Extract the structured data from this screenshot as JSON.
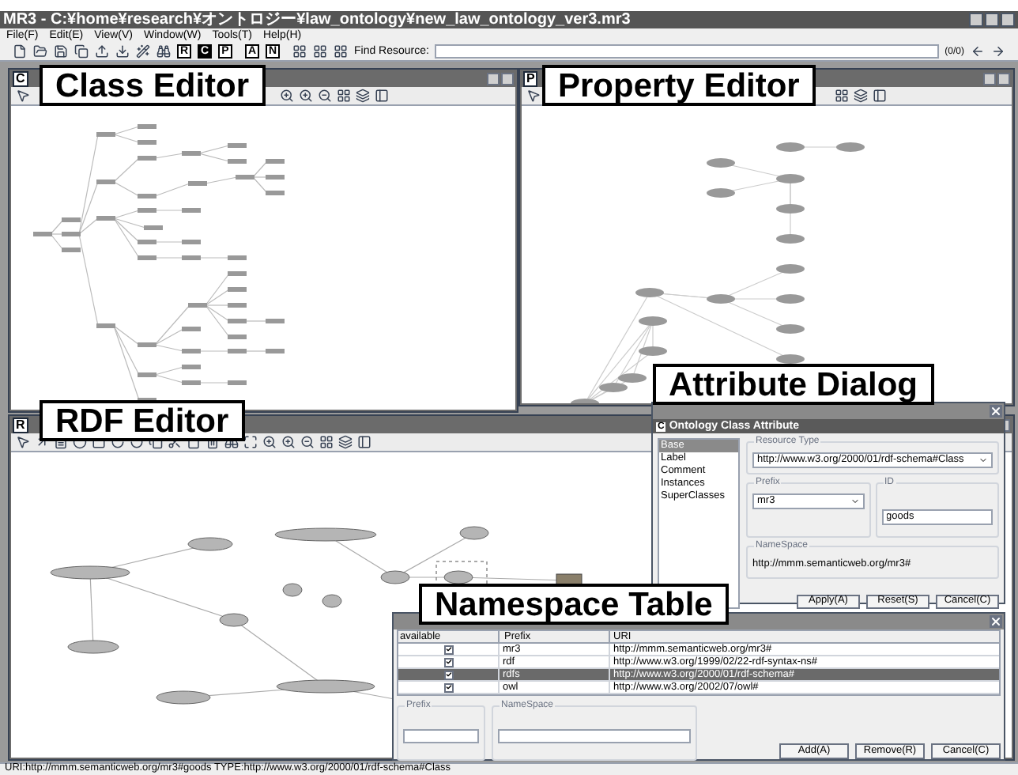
{
  "window": {
    "title": "MR3 - C:¥home¥research¥オントロジー¥law_ontology¥new_law_ontology_ver3.mr3"
  },
  "menu": [
    "File(F)",
    "Edit(E)",
    "View(V)",
    "Window(W)",
    "Tools(T)",
    "Help(H)"
  ],
  "toolbar": {
    "letter_buttons": [
      "R",
      "C",
      "P",
      "A",
      "N"
    ],
    "find_label": "Find Resource:",
    "counter": "(0/0)"
  },
  "editors": [
    {
      "kind": "class",
      "badge": "C",
      "callout": "Class Editor"
    },
    {
      "kind": "property",
      "badge": "P",
      "callout": "Property Editor"
    },
    {
      "kind": "rdf",
      "badge": "R",
      "callout": "RDF Editor"
    }
  ],
  "attribute_dialog": {
    "callout": "Attribute Dialog",
    "badge": "C",
    "title": "Ontology Class Attribute",
    "tabs": [
      {
        "label": "Base",
        "selected": true
      },
      {
        "label": "Label",
        "selected": false
      },
      {
        "label": "Comment",
        "selected": false
      },
      {
        "label": "Instances",
        "selected": false
      },
      {
        "label": "SuperClasses",
        "selected": false
      }
    ],
    "resource_type_label": "Resource Type",
    "resource_type": "http://www.w3.org/2000/01/rdf-schema#Class",
    "prefix_label": "Prefix",
    "prefix": "mr3",
    "id_label": "ID",
    "id": "goods",
    "namespace_label": "NameSpace",
    "namespace": "http://mmm.semanticweb.org/mr3#",
    "buttons": [
      "Apply(A)",
      "Reset(S)",
      "Cancel(C)"
    ]
  },
  "namespace_table": {
    "callout": "Namespace Table",
    "columns": [
      "available",
      "Prefix",
      "URI"
    ],
    "rows": [
      {
        "checked": true,
        "selected": false,
        "prefix": "mr3",
        "uri": "http://mmm.semanticweb.org/mr3#"
      },
      {
        "checked": true,
        "selected": false,
        "prefix": "rdf",
        "uri": "http://www.w3.org/1999/02/22-rdf-syntax-ns#"
      },
      {
        "checked": true,
        "selected": true,
        "prefix": "rdfs",
        "uri": "http://www.w3.org/2000/01/rdf-schema#"
      },
      {
        "checked": true,
        "selected": false,
        "prefix": "owl",
        "uri": "http://www.w3.org/2002/07/owl#"
      }
    ],
    "prefix_label": "Prefix",
    "namespace_label": "NameSpace",
    "buttons": [
      "Add(A)",
      "Remove(R)",
      "Cancel(C)"
    ]
  },
  "status_bar": "URI:http://mmm.semanticweb.org/mr3#goods  TYPE:http://www.w3.org/2000/01/rdf-schema#Class"
}
